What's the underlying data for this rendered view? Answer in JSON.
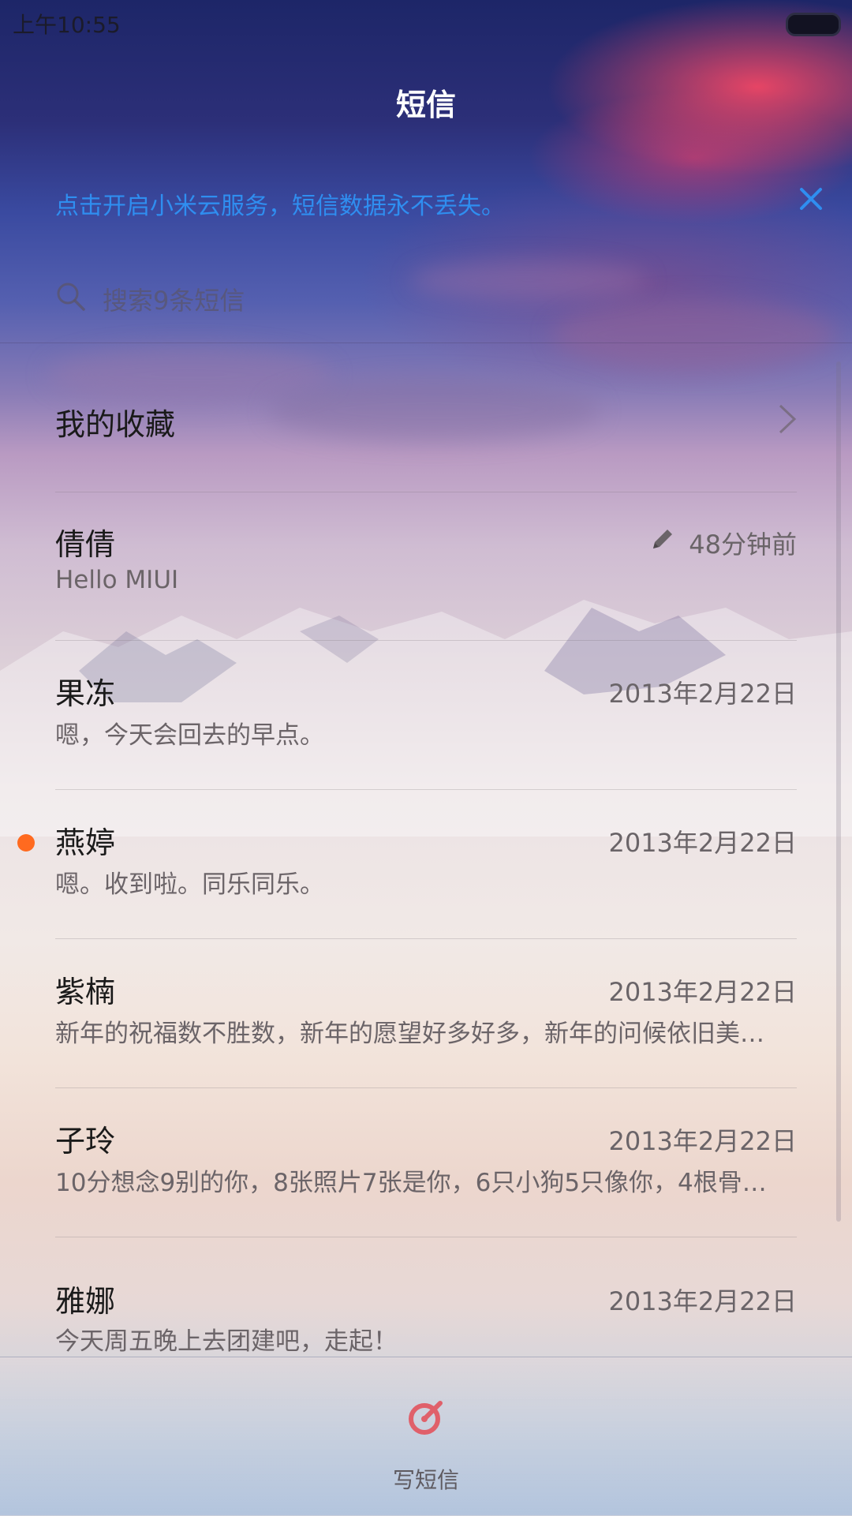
{
  "status_bar": {
    "time": "上午10:55"
  },
  "header": {
    "title": "短信"
  },
  "banner": {
    "text": "点击开启小米云服务，短信数据永不丢失。"
  },
  "search": {
    "placeholder": "搜索9条短信"
  },
  "favorites": {
    "label": "我的收藏"
  },
  "threads": [
    {
      "name": "倩倩",
      "time": "48分钟前",
      "preview": "Hello MIUI",
      "draft": true,
      "unread": false
    },
    {
      "name": "果冻",
      "time": "2013年2月22日",
      "preview": "嗯，今天会回去的早点。",
      "draft": false,
      "unread": false
    },
    {
      "name": "燕婷",
      "time": "2013年2月22日",
      "preview": "嗯。收到啦。同乐同乐。",
      "draft": false,
      "unread": true
    },
    {
      "name": "紫楠",
      "time": "2013年2月22日",
      "preview": "新年的祝福数不胜数，新年的愿望好多好多，新年的问候依旧美…",
      "draft": false,
      "unread": false
    },
    {
      "name": "子玲",
      "time": "2013年2月22日",
      "preview": "10分想念9别的你，8张照片7张是你，6只小狗5只像你，4根骨…",
      "draft": false,
      "unread": false
    },
    {
      "name": "雅娜",
      "time": "2013年2月22日",
      "preview": "今天周五晚上去团建吧，走起！",
      "draft": false,
      "unread": false
    }
  ],
  "bottom": {
    "compose_label": "写短信"
  },
  "colors": {
    "accent_blue": "#2f8ef0",
    "unread_dot": "#ff6a1f",
    "compose_icon": "#e0606a"
  },
  "icons": [
    "search-icon",
    "close-icon",
    "chevron-right-icon",
    "pencil-icon",
    "compose-icon"
  ]
}
